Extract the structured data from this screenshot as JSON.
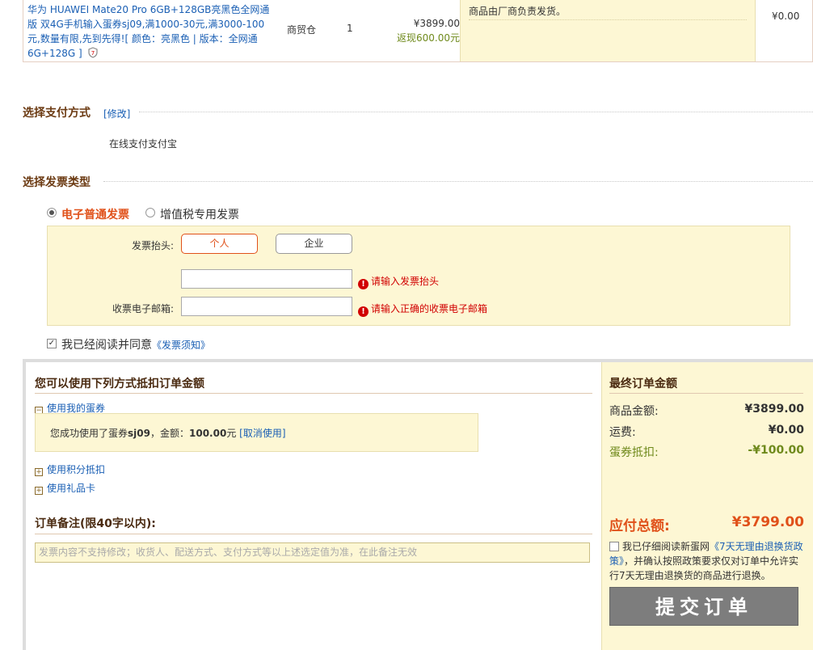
{
  "product": {
    "name_line": "华为 HUAWEI Mate20 Pro 6GB+128GB亮黑色全网通版 双4G手机输入蛋券sj09,满1000-30元,满3000-100元,数量有限,先到先得!",
    "attrs": "[ 颜色：亮黑色 | 版本：全网通 6G+128G ]",
    "warehouse": "商贸仓",
    "qty": "1",
    "price": "¥3899.00",
    "rebate": "返现600.00元",
    "notice": "商品由厂商负责发货。",
    "fee": "¥0.00"
  },
  "payment": {
    "title": "选择支付方式",
    "edit": "[修改]",
    "method": "在线支付支付宝"
  },
  "invoice": {
    "title": "选择发票类型",
    "type_electronic": "电子普通发票",
    "type_vat": "增值税专用发票",
    "header_label": "发票抬头:",
    "btn_personal": "个人",
    "btn_company": "企业",
    "header_error": "请输入发票抬头",
    "email_label": "收票电子邮箱:",
    "email_error": "请输入正确的收票电子邮箱",
    "agree_text": "我已经阅读并同意",
    "agree_link": "《发票须知》"
  },
  "discount": {
    "title": "您可以使用下列方式抵扣订单金额",
    "coupon_toggle": "使用我的蛋券",
    "coupon_msg_pre": "您成功使用了蛋券",
    "coupon_code": "sj09",
    "coupon_msg_mid": "，金额：",
    "coupon_amount": "100.00",
    "coupon_unit": "元",
    "coupon_cancel": "[取消使用]",
    "points_toggle": "使用积分抵扣",
    "giftcard_toggle": "使用礼品卡"
  },
  "remark": {
    "title": "订单备注(限40字以内):",
    "placeholder": "发票内容不支持修改；收货人、配送方式、支付方式等以上述选定值为准，在此备注无效"
  },
  "summary": {
    "title": "最终订单金额",
    "goods_label": "商品金额:",
    "goods_val": "¥3899.00",
    "ship_label": "运费:",
    "ship_val": "¥0.00",
    "coupon_label": "蛋券抵扣:",
    "coupon_val": "-¥100.00",
    "total_label": "应付总额:",
    "total_val": "¥3799.00",
    "policy_pre": "我已仔细阅读新蛋网",
    "policy_link": "《7天无理由退换货政策》",
    "policy_post": "，并确认按照政策要求仅对订单中允许实行7天无理由退换货的商品进行退换。",
    "submit": "提交订单"
  },
  "colors": {
    "accent": "#e0511a",
    "link": "#1a5fb4",
    "panel": "#fdf7d4",
    "green": "#6f8a1c"
  }
}
